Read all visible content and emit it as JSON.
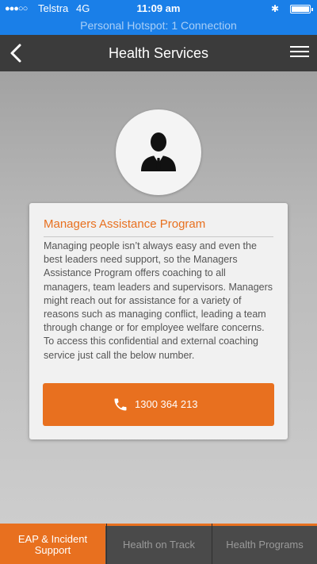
{
  "status_bar": {
    "signal": "●●●○○",
    "carrier": "Telstra",
    "network": "4G",
    "time": "11:09 am",
    "hotspot": "Personal Hotspot: 1 Connection"
  },
  "nav": {
    "title": "Health Services"
  },
  "card": {
    "title": "Managers Assistance Program",
    "body": "Managing people isn’t always easy and even the best leaders need support, so the Managers Assistance Program offers coaching to all managers, team leaders and supervisors. Managers might reach out for assistance for a variety of reasons such as managing conflict, leading a team through change or for employee welfare concerns. To access this confidential and external coaching service just call the below number.",
    "phone": "1300 364 213"
  },
  "tabs": [
    {
      "label": "EAP & Incident Support",
      "active": true
    },
    {
      "label": "Health on Track",
      "active": false
    },
    {
      "label": "Health Programs",
      "active": false
    }
  ],
  "colors": {
    "status_bar": "#1a7fe8",
    "nav_bar": "#3b3b3b",
    "accent": "#e8701f",
    "tab_bar": "#4a4a4a"
  },
  "icons": {
    "back": "chevron-left-icon",
    "menu": "hamburger-menu-icon",
    "avatar": "businessman-icon",
    "phone": "phone-icon"
  }
}
